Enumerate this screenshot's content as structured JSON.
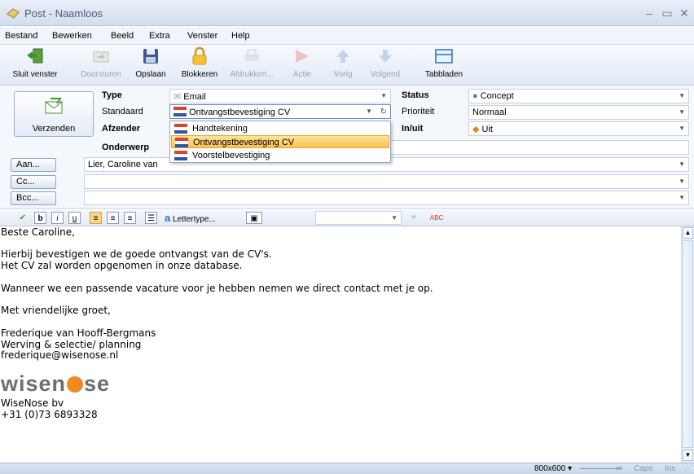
{
  "window": {
    "title": "Post - Naamloos"
  },
  "menu": [
    "Bestand",
    "Bewerken",
    "Beeld",
    "Extra",
    "Venster",
    "Help"
  ],
  "toolbar": {
    "close": "Sluit venster",
    "forward": "Doorsturen",
    "save": "Opslaan",
    "block": "Blokkeren",
    "print": "Afdrukken...",
    "action": "Actie",
    "prev": "Vorig",
    "next": "Volgend",
    "tabs": "Tabbladen"
  },
  "header": {
    "send_label": "Verzenden",
    "type_label": "Type",
    "type_value": "Email",
    "standard_label": "Standaard",
    "standard_value": "Ontvangstbevestiging CV",
    "sender_label": "Afzender",
    "subject_label": "Onderwerp",
    "status_label": "Status",
    "status_value": "Concept",
    "priority_label": "Prioriteit",
    "priority_value": "Normaal",
    "inout_label": "In/uit",
    "inout_value": "Uit",
    "to_button": "Aan...",
    "to_value": "Lier, Caroline van",
    "cc_button": "Cc...",
    "bcc_button": "Bcc..."
  },
  "dropdown": {
    "items": [
      "Handtekening",
      "Ontvangstbevestiging CV",
      "Voorstelbevestiging"
    ]
  },
  "format": {
    "font_button": "Lettertype..."
  },
  "body": {
    "greeting": "Beste Caroline,",
    "line1": "Hierbij bevestigen we de goede ontvangst van de CV's.",
    "line2": "Het CV zal worden opgenomen in onze database.",
    "line3": "Wanneer we een passende vacature voor je hebben nemen we direct contact met je op.",
    "closing": "Met vriendelijke groet,",
    "sig_name": "Frederique van Hooff-Bergmans",
    "sig_role": "Werving & selectie/ planning",
    "sig_email": "frederique@wisenose.nl",
    "logo_left": "wisen",
    "logo_right": "se",
    "company": "WiseNose bv",
    "phone": "+31 (0)73 6893328"
  },
  "statusbar": {
    "resolution": "800x600 ▾",
    "caps": "Caps",
    "ins": "Ins"
  },
  "colors": {
    "accent": "#3b6fb6",
    "selected": "#fbc150",
    "logo_orange": "#f08a1c",
    "logo_gray": "#6f6f6f"
  }
}
